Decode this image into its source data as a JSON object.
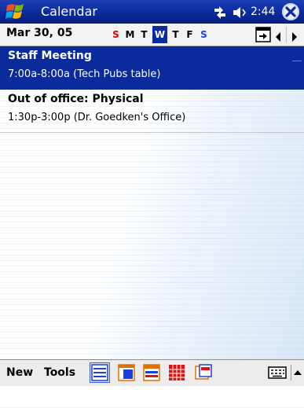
{
  "title_bar": {
    "app_title": "Calendar",
    "clock": "2:44",
    "icons": {
      "start": "windows-start-icon",
      "connectivity": "connectivity-icon",
      "volume": "volume-icon",
      "close": "close-icon"
    }
  },
  "date_bar": {
    "date": "Mar 30, 05",
    "days": [
      "S",
      "M",
      "T",
      "W",
      "T",
      "F",
      "S"
    ],
    "selected_day_index": 3,
    "icons": {
      "goto_today": "goto-today-icon",
      "prev": "chevron-left-icon",
      "next": "chevron-right-icon"
    }
  },
  "appointments": [
    {
      "subject": "Staff Meeting",
      "details": "7:00a-8:00a (Tech Pubs table)",
      "selected": true
    },
    {
      "subject": "Out of office: Physical",
      "details": "1:30p-3:00p (Dr. Goedken's Office)",
      "selected": false
    }
  ],
  "menu_bar": {
    "new_label": "New",
    "tools_label": "Tools",
    "views": [
      "agenda-view-icon",
      "day-view-icon",
      "week-view-icon",
      "month-view-icon",
      "year-view-icon"
    ],
    "active_view_index": 0,
    "icons": {
      "input_panel": "keyboard-icon",
      "input_menu": "chevron-up-icon"
    }
  },
  "colors": {
    "title_bar": "#0b2b9c",
    "selection": "#0b2b9c",
    "weekend_sunday": "#e00000",
    "weekend_saturday": "#1f3ee0"
  }
}
